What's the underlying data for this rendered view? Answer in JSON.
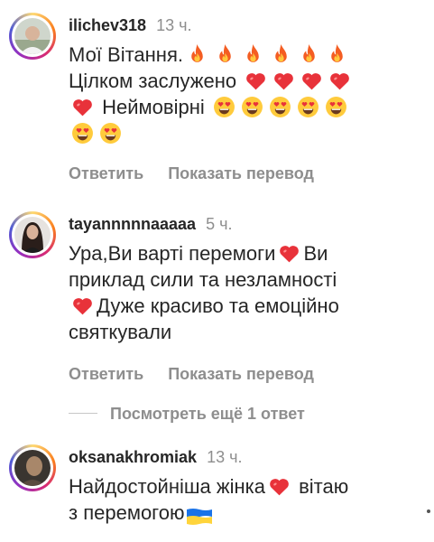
{
  "comments": [
    {
      "username": "ilichev318",
      "time": "13 ч.",
      "text": [
        {
          "t": "Мої Вітання."
        },
        {
          "e": "fire"
        },
        {
          "e": "fire"
        },
        {
          "e": "fire"
        },
        {
          "e": "fire"
        },
        {
          "e": "fire"
        },
        {
          "e": "fire"
        },
        {
          "br": true
        },
        {
          "t": "Цілком заслужено "
        },
        {
          "e": "heart"
        },
        {
          "e": "heart"
        },
        {
          "e": "heart"
        },
        {
          "e": "heart"
        },
        {
          "br": true
        },
        {
          "e": "heart"
        },
        {
          "t": " Неймовірні "
        },
        {
          "e": "heart_eyes"
        },
        {
          "e": "heart_eyes"
        },
        {
          "e": "heart_eyes"
        },
        {
          "e": "heart_eyes"
        },
        {
          "e": "heart_eyes"
        },
        {
          "br": true
        },
        {
          "e": "heart_eyes"
        },
        {
          "e": "heart_eyes"
        }
      ],
      "actions": {
        "reply": "Ответить",
        "translate": "Показать перевод"
      }
    },
    {
      "username": "tayannnnnaaaaa",
      "time": "5 ч.",
      "text": [
        {
          "t": "Ура,Ви варті перемоги"
        },
        {
          "e": "heart"
        },
        {
          "t": "Ви"
        },
        {
          "br": true
        },
        {
          "t": "приклад сили та незламності"
        },
        {
          "br": true
        },
        {
          "e": "heart"
        },
        {
          "t": "Дуже красиво та емоційно"
        },
        {
          "br": true
        },
        {
          "t": "святкували"
        }
      ],
      "actions": {
        "reply": "Ответить",
        "translate": "Показать перевод"
      }
    },
    {
      "username": "oksanakhromiak",
      "time": "13 ч.",
      "text": [
        {
          "t": "Найдостойніша жінка"
        },
        {
          "e": "heart"
        },
        {
          "t": " вітаю"
        },
        {
          "br": true
        },
        {
          "t": "з перемогою"
        },
        {
          "e": "ua_flag"
        }
      ]
    }
  ],
  "more_replies": "Посмотреть ещё 1 ответ"
}
